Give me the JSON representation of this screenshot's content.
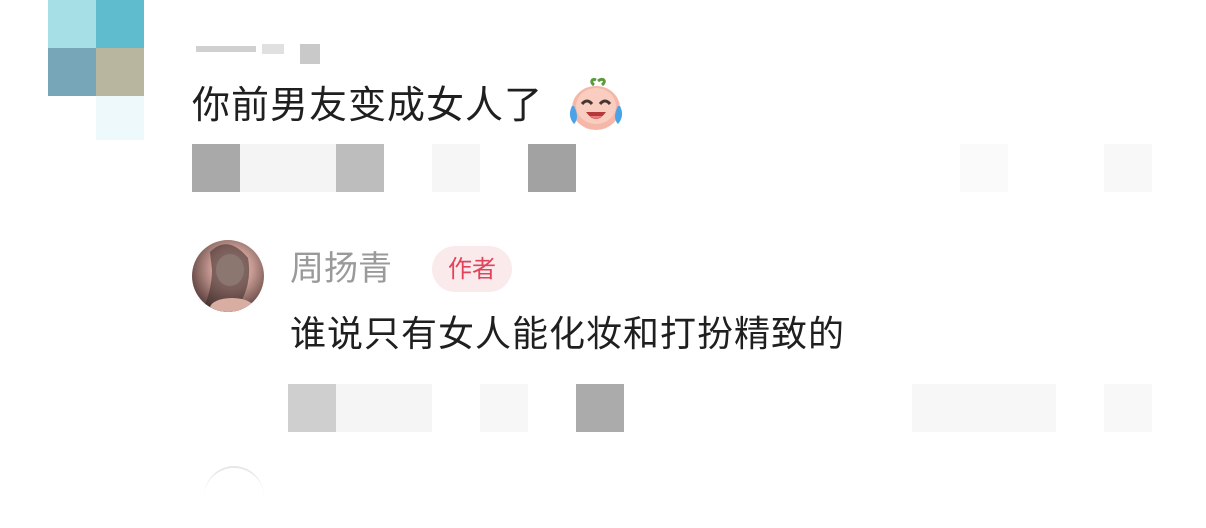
{
  "comment": {
    "text": "你前男友变成女人了",
    "emoji_icon": "crying-laughing-face-icon"
  },
  "reply": {
    "author": "周扬青",
    "badge": "作者",
    "text": "谁说只有女人能化妆和打扮精致的",
    "avatar_icon": "user-avatar"
  },
  "colors": {
    "text": "#1f1f1f",
    "author": "#9a9a9a",
    "badge_text": "#e0435a",
    "badge_bg": "#fbeaec"
  }
}
